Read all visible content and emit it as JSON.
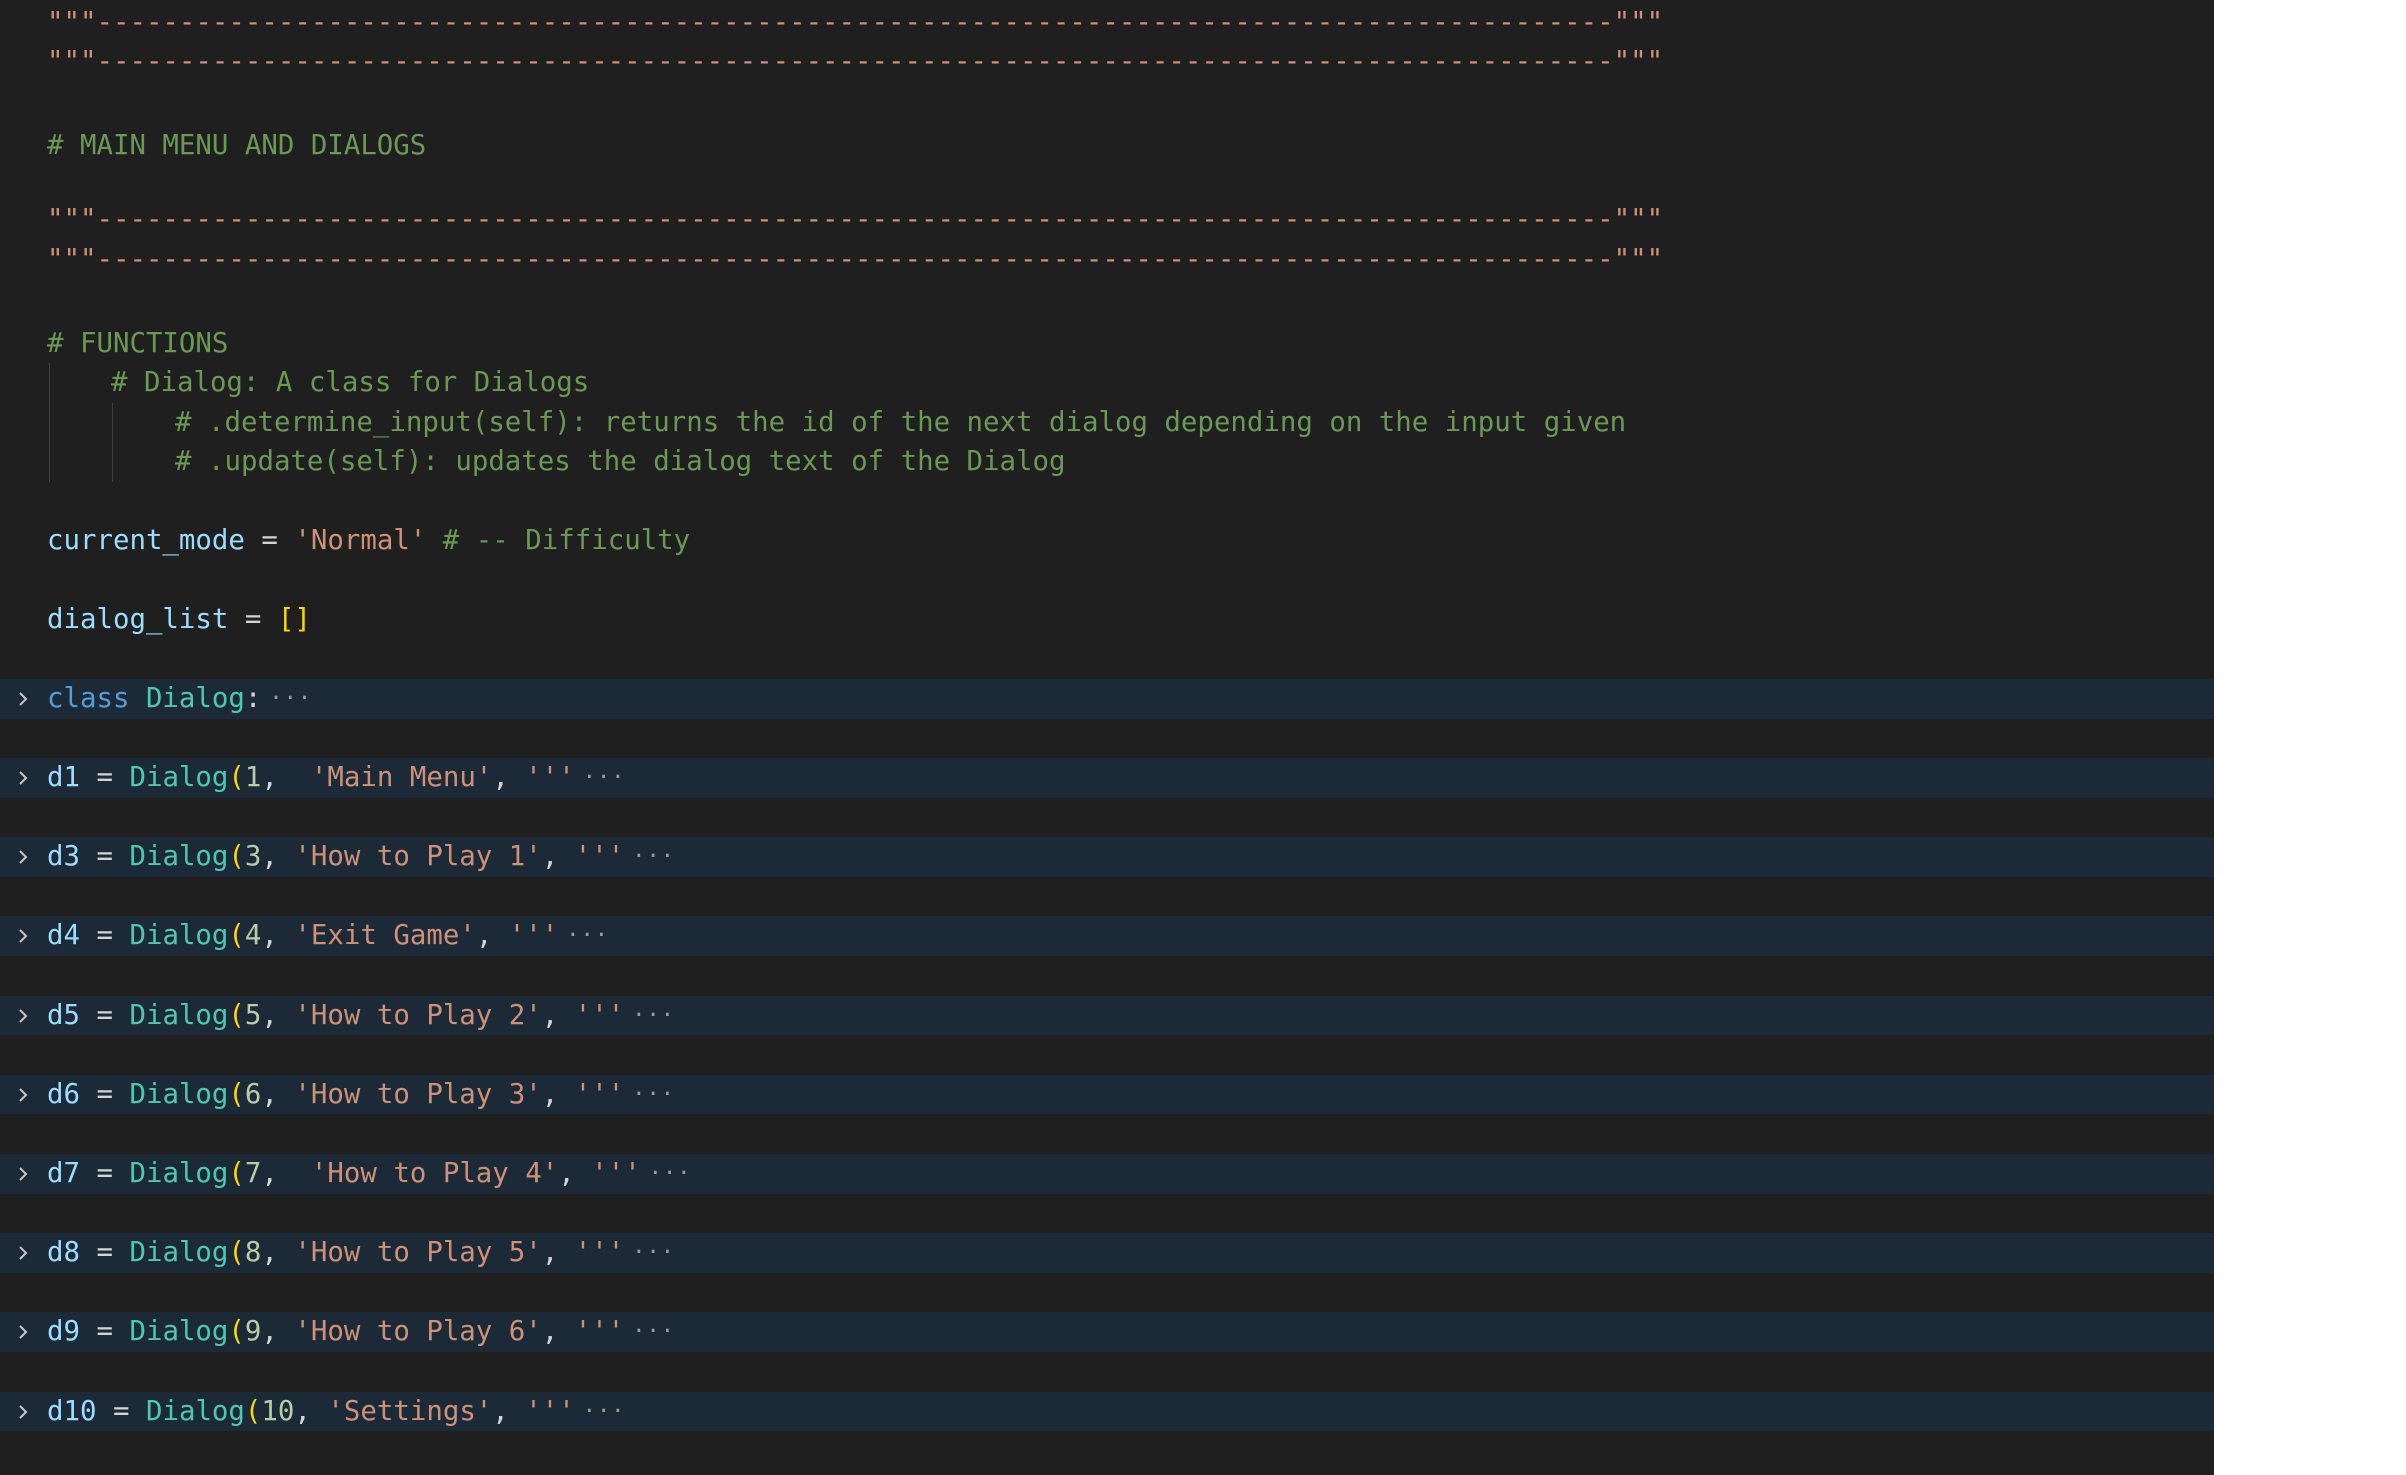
{
  "editor": {
    "separator_line": "\"\"\"--------------------------------------------------------------------------------------------\"\"\"",
    "header_comment": "# MAIN MENU AND DIALOGS",
    "functions_comment": "# FUNCTIONS",
    "dialog_class_comment": "# Dialog: A class for Dialogs",
    "determine_input_comment": "# .determine_input(self): returns the id of the next dialog depending on the input given",
    "update_comment": "# .update(self): updates the dialog text of the Dialog",
    "current_mode": {
      "name": "current_mode",
      "op": " = ",
      "value": "'Normal'",
      "comment": " # -- Difficulty"
    },
    "dialog_list": {
      "name": "dialog_list",
      "op": " = ",
      "value": "[]"
    },
    "class_line": {
      "keyword": "class",
      "name": " Dialog",
      "colon": ":"
    },
    "fold_ellipsis": "···",
    "dialog_lines": [
      {
        "var": "d1",
        "num": "1",
        "sep": ",  ",
        "title": "'Main Menu'"
      },
      {
        "var": "d3",
        "num": "3",
        "sep": ", ",
        "title": "'How to Play 1'"
      },
      {
        "var": "d4",
        "num": "4",
        "sep": ", ",
        "title": "'Exit Game'"
      },
      {
        "var": "d5",
        "num": "5",
        "sep": ", ",
        "title": "'How to Play 2'"
      },
      {
        "var": "d6",
        "num": "6",
        "sep": ", ",
        "title": "'How to Play 3'"
      },
      {
        "var": "d7",
        "num": "7",
        "sep": ",  ",
        "title": "'How to Play 4'"
      },
      {
        "var": "d8",
        "num": "8",
        "sep": ", ",
        "title": "'How to Play 5'"
      },
      {
        "var": "d9",
        "num": "9",
        "sep": ", ",
        "title": "'How to Play 6'"
      },
      {
        "var": "d10",
        "num": "10",
        "sep": ", ",
        "title": "'Settings'"
      }
    ],
    "dialog_call": {
      "op": " = ",
      "cls": "Dialog",
      "open_paren": "(",
      "after_title": ", ",
      "triple_quote": "'''"
    },
    "colors": {
      "background": "#1f1f1f",
      "folded_highlight": "#1c2a38",
      "string": "#ce9178",
      "comment": "#6a9955",
      "variable": "#9cdcfe",
      "keyword": "#569cd6",
      "class": "#4ec9b0",
      "number": "#b5cea8",
      "bracket": "#ffd700"
    }
  }
}
